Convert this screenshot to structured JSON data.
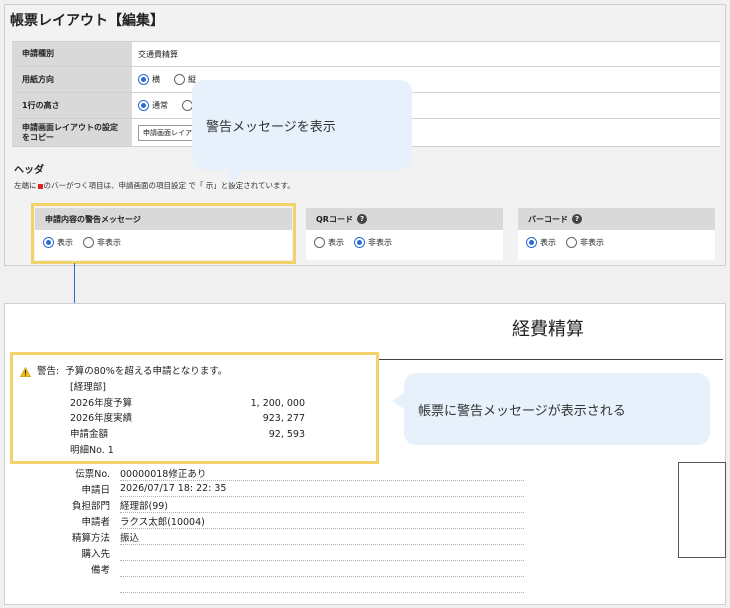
{
  "page_title": "帳票レイアウト【編集】",
  "form": {
    "rows": [
      {
        "label": "申請種別",
        "value": "交通費精算"
      },
      {
        "label": "用紙方向",
        "options": [
          "横",
          "縦"
        ],
        "selected": "横"
      },
      {
        "label": "1行の高さ",
        "options": [
          "通常",
          ""
        ],
        "selected": "通常"
      },
      {
        "label": "申請画面レイアウトの設定をコピー",
        "select_value": "申請画面レイア"
      }
    ]
  },
  "header_section": {
    "heading": "ヘッダ",
    "note_before": "左端に",
    "note_after": "のバーがつく項目は、申請画面の項目設定 で「     示」と設定されています。"
  },
  "settings": [
    {
      "label": "申請内容の警告メッセージ",
      "options": [
        "表示",
        "非表示"
      ],
      "selected": "表示",
      "help": false
    },
    {
      "label": "QRコード",
      "options": [
        "表示",
        "非表示"
      ],
      "selected": "非表示",
      "help": true
    },
    {
      "label": "バーコード",
      "options": [
        "表示",
        "非表示"
      ],
      "selected": "表示",
      "help": true
    }
  ],
  "callouts": {
    "top": "警告メッセージを表示",
    "bottom": "帳票に警告メッセージが表示される"
  },
  "document": {
    "title": "経費精算",
    "warning": {
      "label": "警告:",
      "message": "予算の80%を超える申請となります。",
      "department": "[経理部]",
      "rows": [
        {
          "key": "2026年度予算",
          "value": "1, 200, 000"
        },
        {
          "key": "2026年度実績",
          "value": "923, 277"
        },
        {
          "key": "申請金額",
          "value": "92, 593"
        }
      ],
      "detail_no": "明細No.  1"
    },
    "fields": [
      {
        "key": "伝票No.",
        "value": "00000018修正あり"
      },
      {
        "key": "申請日",
        "value": "2026/07/17  18: 22: 35"
      },
      {
        "key": "負担部門",
        "value": "経理部(99)"
      },
      {
        "key": "申請者",
        "value": "ラクス太郎(10004)"
      },
      {
        "key": "精算方法",
        "value": "振込"
      },
      {
        "key": "購入先",
        "value": ""
      },
      {
        "key": "備考",
        "value": ""
      }
    ]
  },
  "colors": {
    "accent": "#2a6bd3",
    "highlight": "#f2d36b",
    "callout_bg": "#e6f1fb",
    "marker": "#d22222"
  }
}
